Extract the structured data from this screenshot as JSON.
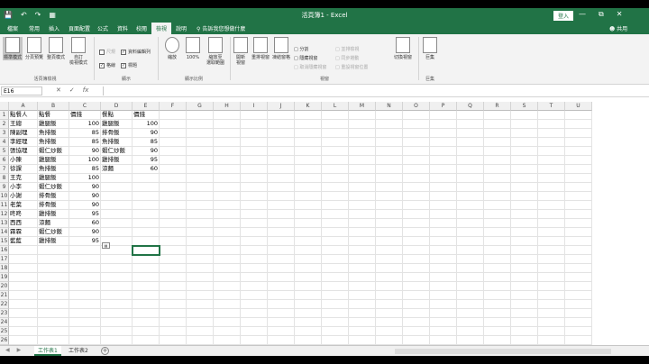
{
  "window": {
    "title": "活頁簿1 - Excel",
    "login_label": "登入",
    "minimize": "—",
    "restore": "⧉",
    "close": "✕"
  },
  "qat": {
    "save": "💾",
    "undo": "↶",
    "redo": "↷",
    "customize": "▦"
  },
  "tabs": [
    "檔案",
    "常用",
    "插入",
    "頁面配置",
    "公式",
    "資料",
    "校閱",
    "檢視",
    "說明"
  ],
  "active_tab": "檢視",
  "tell_me": "告訴我您想做什麼",
  "share": "共用",
  "ribbon": {
    "workbook_views": {
      "normal": "標準模式",
      "page_break": "分頁預覽",
      "page_layout": "整頁模式",
      "custom": "自訂\n檢視模式",
      "group_label": "活頁簿檢視"
    },
    "show": {
      "ruler": "尺規",
      "formula_bar": "資料編輯列",
      "gridlines": "格線",
      "headings": "標題",
      "group_label": "顯示"
    },
    "zoom": {
      "zoom": "縮放",
      "zoom100": "100%",
      "zoom_to_selection": "縮放至\n選取範圍",
      "group_label": "顯示比例"
    },
    "window_group": {
      "new_window": "開新\n視窗",
      "arrange_all": "重排視窗",
      "freeze_panes": "凍結窗格",
      "split": "分割",
      "hide": "隱藏視窗",
      "unhide": "取消隱藏視窗",
      "view_side": "並排檢視",
      "sync_scroll": "同步捲動",
      "reset_position": "重設視窗位置",
      "switch_windows": "切換視窗",
      "group_label": "視窗"
    },
    "macros": {
      "macros": "巨集",
      "group_label": "巨集"
    }
  },
  "formula_bar": {
    "name_box": "E16",
    "cancel": "✕",
    "enter": "✓",
    "fx": "fx",
    "value": ""
  },
  "columns": [
    "A",
    "B",
    "C",
    "D",
    "E",
    "F",
    "G",
    "H",
    "I",
    "J",
    "K",
    "L",
    "M",
    "N",
    "O",
    "P",
    "Q",
    "R",
    "S",
    "T",
    "U"
  ],
  "rows": [
    "1",
    "2",
    "3",
    "4",
    "5",
    "6",
    "7",
    "8",
    "9",
    "10",
    "11",
    "12",
    "13",
    "14",
    "15",
    "16",
    "17",
    "18",
    "19",
    "20",
    "21",
    "22",
    "23",
    "24",
    "25",
    "26"
  ],
  "table_left": {
    "headers": [
      "點餐人",
      "點餐",
      "價錢"
    ],
    "rows": [
      [
        "王總",
        "雞腿飯",
        "100"
      ],
      [
        "陳副理",
        "魚排飯",
        "85"
      ],
      [
        "李經理",
        "魚排飯",
        "85"
      ],
      [
        "張協理",
        "蝦仁炒飯",
        "90"
      ],
      [
        "小陳",
        "雞腿飯",
        "100"
      ],
      [
        "徐課",
        "魚排飯",
        "85"
      ],
      [
        "王克",
        "雞腿飯",
        "100"
      ],
      [
        "小李",
        "蝦仁炒飯",
        "90"
      ],
      [
        "小謝",
        "排骨飯",
        "90"
      ],
      [
        "老葉",
        "排骨飯",
        "90"
      ],
      [
        "咚咚",
        "雞排飯",
        "95"
      ],
      [
        "西西",
        "涼麵",
        "60"
      ],
      [
        "霖霖",
        "蝦仁炒飯",
        "90"
      ],
      [
        "藍藍",
        "雞排飯",
        "95"
      ]
    ]
  },
  "table_right": {
    "headers": [
      "餐點",
      "價錢"
    ],
    "rows": [
      [
        "雞腿飯",
        "100"
      ],
      [
        "排骨飯",
        "90"
      ],
      [
        "魚排飯",
        "85"
      ],
      [
        "蝦仁炒飯",
        "90"
      ],
      [
        "雞排飯",
        "95"
      ],
      [
        "涼麵",
        "60"
      ]
    ]
  },
  "sheets": [
    "工作表1",
    "工作表2"
  ],
  "active_sheet": "工作表1",
  "add_sheet": "+"
}
